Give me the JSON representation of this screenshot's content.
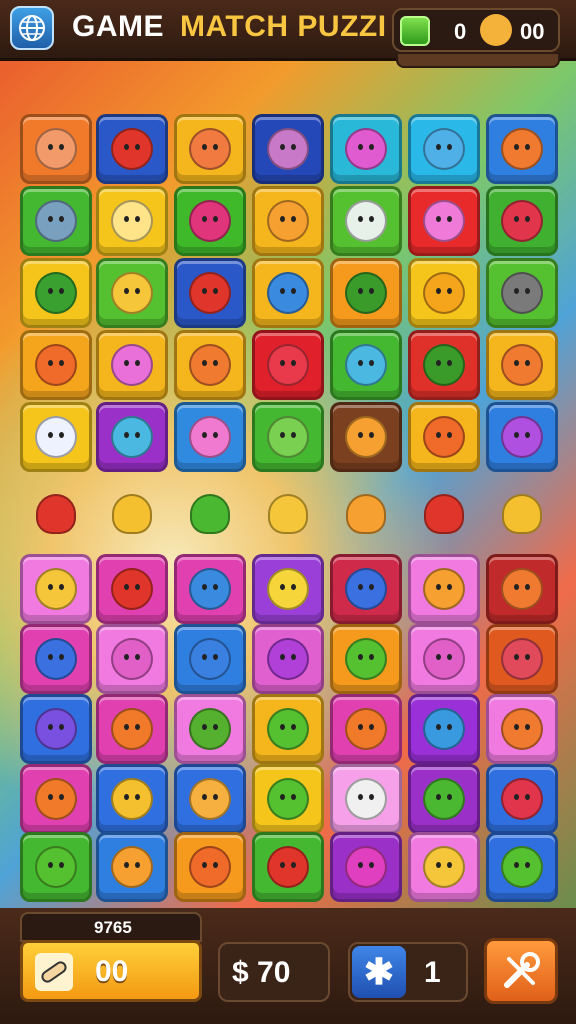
{
  "header": {
    "title_left": "GAME",
    "title_right": "MATCH PUZZI",
    "gem_count": "0",
    "lives_count": "00"
  },
  "board": {
    "top_rows": [
      [
        {
          "bg": "#f07a2a",
          "icon": "#f29a6a",
          "name": "cat-face"
        },
        {
          "bg": "#2b58c8",
          "icon": "#e0352a",
          "name": "apple"
        },
        {
          "bg": "#f5b51c",
          "icon": "#f07a40",
          "name": "cat-face"
        },
        {
          "bg": "#2548b8",
          "icon": "#c879c8",
          "name": "cat-face"
        },
        {
          "bg": "#29b8d8",
          "icon": "#e05ad0",
          "name": "round-face"
        },
        {
          "bg": "#29b8e8",
          "icon": "#4fb0e8",
          "name": "leaf"
        },
        {
          "bg": "#2f7fe0",
          "icon": "#f07a30",
          "name": "cat-face"
        }
      ],
      [
        {
          "bg": "#44b830",
          "icon": "#7aa0c0",
          "name": "phone"
        },
        {
          "bg": "#f5c51c",
          "icon": "#ffe48a",
          "name": "ghost"
        },
        {
          "bg": "#3fb82a",
          "icon": "#e0357a",
          "name": "apple"
        },
        {
          "bg": "#f5b51c",
          "icon": "#f5a030",
          "name": "pear"
        },
        {
          "bg": "#55c030",
          "icon": "#e8f0ea",
          "name": "robot"
        },
        {
          "bg": "#e82a2a",
          "icon": "#f07ad8",
          "name": "lollipop"
        },
        {
          "bg": "#3fb030",
          "icon": "#e0354a",
          "name": "palm-tree"
        }
      ],
      [
        {
          "bg": "#f5c51c",
          "icon": "#3aa030",
          "name": "chip"
        },
        {
          "bg": "#55c030",
          "icon": "#f5c53a",
          "name": "round-face"
        },
        {
          "bg": "#2b58c8",
          "icon": "#e0352a",
          "name": "round-face"
        },
        {
          "bg": "#f5b51c",
          "icon": "#3a8ae0",
          "name": "cat-face"
        },
        {
          "bg": "#f59a1c",
          "icon": "#3a9a2a",
          "name": "leaf"
        },
        {
          "bg": "#f5c51c",
          "icon": "#f5a51c",
          "name": "feather"
        },
        {
          "bg": "#55c030",
          "icon": "#7a7a7a",
          "name": "crossed-tools"
        }
      ],
      [
        {
          "bg": "#f5a51c",
          "icon": "#f06a2a",
          "name": "round-face"
        },
        {
          "bg": "#f5b51c",
          "icon": "#e870d8",
          "name": "leaf"
        },
        {
          "bg": "#f5b51c",
          "icon": "#f07a30",
          "name": "cat-face"
        },
        {
          "bg": "#e0202a",
          "icon": "#e83a4a",
          "name": "round-face"
        },
        {
          "bg": "#44b830",
          "icon": "#4ab8e0",
          "name": "cat-face"
        },
        {
          "bg": "#e0302a",
          "icon": "#3a9a2a",
          "name": "no-sign"
        },
        {
          "bg": "#f5b51c",
          "icon": "#f07a30",
          "name": "cat-face"
        }
      ],
      [
        {
          "bg": "#f5c51c",
          "icon": "#eef2ff",
          "name": "ghost-face"
        },
        {
          "bg": "#9a30c8",
          "icon": "#4ab8e0",
          "name": "leaf"
        },
        {
          "bg": "#2f8ae0",
          "icon": "#f07ad0",
          "name": "cat-face"
        },
        {
          "bg": "#44b830",
          "icon": "#7ad050",
          "name": "leaf-card"
        },
        {
          "bg": "#7a4020",
          "icon": "#f5a030",
          "name": "crossed-sticks"
        },
        {
          "bg": "#f5b51c",
          "icon": "#f06a2a",
          "name": "round-face"
        },
        {
          "bg": "#2f7fe0",
          "icon": "#b050e0",
          "name": "lollipop"
        }
      ]
    ],
    "loose_items": [
      {
        "icon": "#e0352a",
        "name": "cherry-figure"
      },
      {
        "icon": "#f5c030",
        "name": "pear-figure"
      },
      {
        "icon": "#4ab830",
        "name": "pea-pod"
      },
      {
        "icon": "#f5c53a",
        "name": "spiral-figure"
      },
      {
        "icon": "#f5a030",
        "name": "crossed-sticks"
      },
      {
        "icon": "#e0352a",
        "name": "curly-figure"
      },
      {
        "icon": "#f5c030",
        "name": "puzzle-piece"
      }
    ],
    "bottom_rows": [
      [
        {
          "bg": "#f07ae0",
          "icon": "#f5c53a",
          "name": "round-face"
        },
        {
          "bg": "#e040b0",
          "icon": "#e0352a",
          "name": "cat-face"
        },
        {
          "bg": "#e040b0",
          "icon": "#3a8ae0",
          "name": "cat-face"
        },
        {
          "bg": "#9a40d8",
          "icon": "#f5d53a",
          "name": "round-face"
        },
        {
          "bg": "#d02a4a",
          "icon": "#3a70e0",
          "name": "round-face"
        },
        {
          "bg": "#f07ae0",
          "icon": "#f5a030",
          "name": "crossed-tools"
        },
        {
          "bg": "#c02a2a",
          "icon": "#f07a30",
          "name": "cat-face"
        }
      ],
      [
        {
          "bg": "#e040b0",
          "icon": "#3a70e0",
          "name": "round-face"
        },
        {
          "bg": "#f07ae0",
          "icon": "#e060c8",
          "name": "cat-face"
        },
        {
          "bg": "#2f7fe0",
          "icon": "#3a80e0",
          "name": "round-face"
        },
        {
          "bg": "#e060d0",
          "icon": "#b040d8",
          "name": "round-face"
        },
        {
          "bg": "#f59a1c",
          "icon": "#55c030",
          "name": "round-face"
        },
        {
          "bg": "#f07ae0",
          "icon": "#e060c8",
          "name": "cat-face"
        },
        {
          "bg": "#e05a20",
          "icon": "#e04a5a",
          "name": "round-face"
        }
      ],
      [
        {
          "bg": "#2f6fe0",
          "icon": "#7a50e0",
          "name": "lollipop"
        },
        {
          "bg": "#e040b0",
          "icon": "#f07a2a",
          "name": "orange"
        },
        {
          "bg": "#f07ae0",
          "icon": "#55b030",
          "name": "apple"
        },
        {
          "bg": "#f5b51c",
          "icon": "#55c030",
          "name": "cat-face"
        },
        {
          "bg": "#e040b0",
          "icon": "#f07a2a",
          "name": "orange"
        },
        {
          "bg": "#9a30d8",
          "icon": "#3a9ae0",
          "name": "leaf"
        },
        {
          "bg": "#f07ae0",
          "icon": "#f07a30",
          "name": "cat-face"
        }
      ],
      [
        {
          "bg": "#e040b0",
          "icon": "#f07a2a",
          "name": "orange"
        },
        {
          "bg": "#2f6fe0",
          "icon": "#f5c030",
          "name": "stick"
        },
        {
          "bg": "#2f6fe0",
          "icon": "#f5b040",
          "name": "cat-face"
        },
        {
          "bg": "#f5c51c",
          "icon": "#55c030",
          "name": "cat-face"
        },
        {
          "bg": "#f5a0e8",
          "icon": "#f0f0f0",
          "name": "cat-face"
        },
        {
          "bg": "#9a30c8",
          "icon": "#4ab830",
          "name": "frog"
        },
        {
          "bg": "#2f6fe0",
          "icon": "#e0354a",
          "name": "leaf"
        }
      ],
      [
        {
          "bg": "#44b830",
          "icon": "#55c030",
          "name": "cat-face"
        },
        {
          "bg": "#2f7fe0",
          "icon": "#f5a030",
          "name": "round-face"
        },
        {
          "bg": "#f59a1c",
          "icon": "#f06a2a",
          "name": "cat-face"
        },
        {
          "bg": "#44b830",
          "icon": "#e0352a",
          "name": "round-face"
        },
        {
          "bg": "#9a30c8",
          "icon": "#e040c0",
          "name": "cat-face"
        },
        {
          "bg": "#f07ae0",
          "icon": "#f5c53a",
          "name": "banana"
        },
        {
          "bg": "#2f6fe0",
          "icon": "#55c030",
          "name": "leaf"
        }
      ]
    ]
  },
  "footer": {
    "progress_label": "9765",
    "progress_value": "00",
    "coins_value": "$ 70",
    "boost_value": "1",
    "boost_symbol": "✱"
  }
}
